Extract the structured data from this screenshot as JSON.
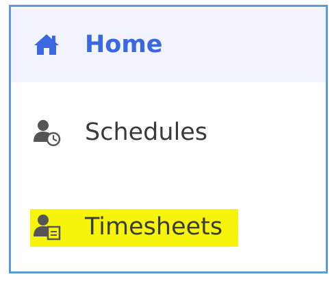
{
  "nav": {
    "items": [
      {
        "label": "Home",
        "icon": "home-icon",
        "active": true
      },
      {
        "label": "Schedules",
        "icon": "user-clock-icon",
        "active": false
      },
      {
        "label": "Timesheets",
        "icon": "user-timesheet-icon",
        "active": false,
        "highlighted": true
      }
    ]
  },
  "colors": {
    "frame_border": "#5b9bd5",
    "active_bg": "#f2f4fd",
    "active_text": "#3b67e0",
    "item_text": "#3a3a3a",
    "icon_gray": "#555555",
    "highlight": "#f6f40b"
  }
}
